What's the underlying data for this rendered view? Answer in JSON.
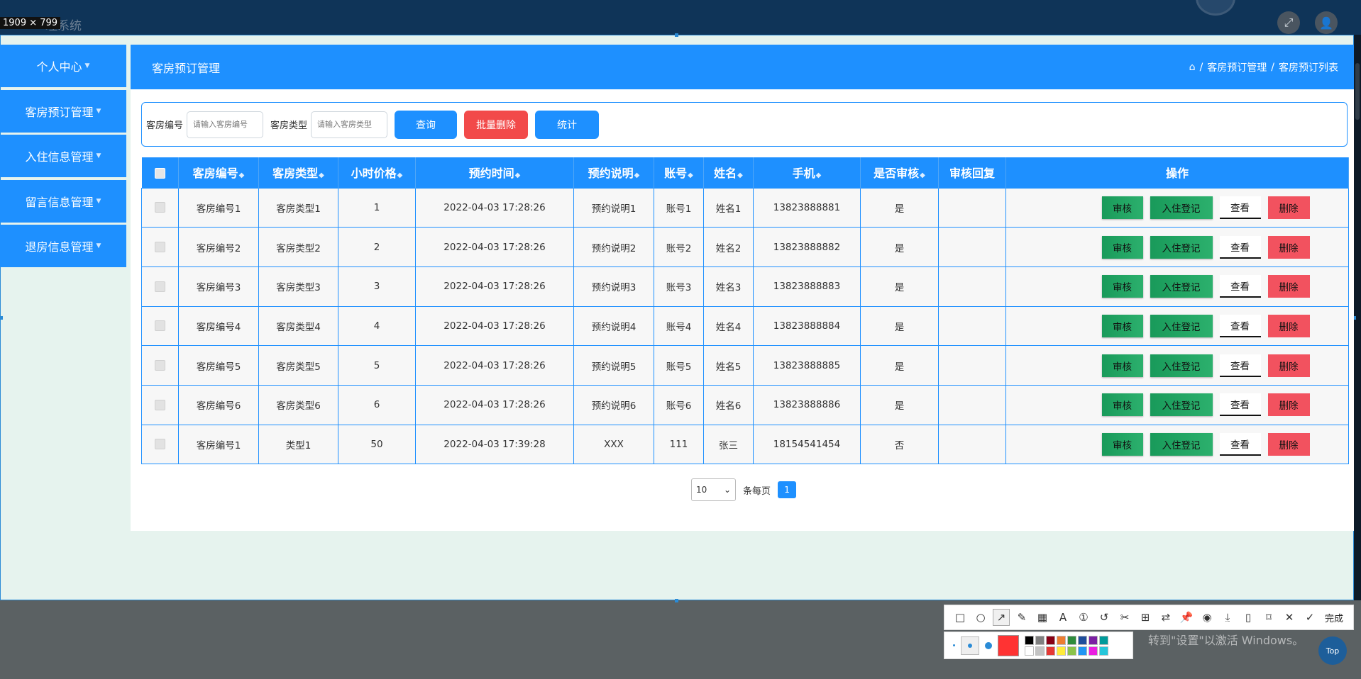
{
  "app": {
    "title_partial": "理系统",
    "screenshot_size": "1909 × 799"
  },
  "sidebar": {
    "items": [
      {
        "label": "个人中心"
      },
      {
        "label": "客房预订管理"
      },
      {
        "label": "入住信息管理"
      },
      {
        "label": "留言信息管理"
      },
      {
        "label": "退房信息管理"
      }
    ]
  },
  "page": {
    "title": "客房预订管理",
    "breadcrumb": [
      "客房预订管理",
      "客房预订列表"
    ]
  },
  "search": {
    "room_no_label": "客房编号",
    "room_no_placeholder": "请输入客房编号",
    "room_type_label": "客房类型",
    "room_type_placeholder": "请输入客房类型",
    "query_label": "查询",
    "batch_delete_label": "批量删除",
    "stats_label": "统计"
  },
  "table": {
    "headers": [
      "客房编号",
      "客房类型",
      "小时价格",
      "预约时间",
      "预约说明",
      "账号",
      "姓名",
      "手机",
      "是否审核",
      "审核回复",
      "操作"
    ],
    "actions": {
      "audit": "审核",
      "checkin": "入住登记",
      "view": "查看",
      "delete": "删除"
    },
    "rows": [
      {
        "room_no": "客房编号1",
        "room_type": "客房类型1",
        "price": "1",
        "time": "2022-04-03 17:28:26",
        "note": "预约说明1",
        "account": "账号1",
        "name": "姓名1",
        "phone": "13823888881",
        "audited": "是",
        "reply": ""
      },
      {
        "room_no": "客房编号2",
        "room_type": "客房类型2",
        "price": "2",
        "time": "2022-04-03 17:28:26",
        "note": "预约说明2",
        "account": "账号2",
        "name": "姓名2",
        "phone": "13823888882",
        "audited": "是",
        "reply": ""
      },
      {
        "room_no": "客房编号3",
        "room_type": "客房类型3",
        "price": "3",
        "time": "2022-04-03 17:28:26",
        "note": "预约说明3",
        "account": "账号3",
        "name": "姓名3",
        "phone": "13823888883",
        "audited": "是",
        "reply": ""
      },
      {
        "room_no": "客房编号4",
        "room_type": "客房类型4",
        "price": "4",
        "time": "2022-04-03 17:28:26",
        "note": "预约说明4",
        "account": "账号4",
        "name": "姓名4",
        "phone": "13823888884",
        "audited": "是",
        "reply": ""
      },
      {
        "room_no": "客房编号5",
        "room_type": "客房类型5",
        "price": "5",
        "time": "2022-04-03 17:28:26",
        "note": "预约说明5",
        "account": "账号5",
        "name": "姓名5",
        "phone": "13823888885",
        "audited": "是",
        "reply": ""
      },
      {
        "room_no": "客房编号6",
        "room_type": "客房类型6",
        "price": "6",
        "time": "2022-04-03 17:28:26",
        "note": "预约说明6",
        "account": "账号6",
        "name": "姓名6",
        "phone": "13823888886",
        "audited": "是",
        "reply": ""
      },
      {
        "room_no": "客房编号1",
        "room_type": "类型1",
        "price": "50",
        "time": "2022-04-03 17:39:28",
        "note": "XXX",
        "account": "111",
        "name": "张三",
        "phone": "18154541454",
        "audited": "否",
        "reply": ""
      }
    ]
  },
  "pagination": {
    "page_size": "10",
    "per_page_label": "条每页",
    "current_page": "1"
  },
  "snip_toolbar": {
    "finish_label": "完成",
    "palette": [
      "#000000",
      "#7f7f7f",
      "#880015",
      "#ed7d31",
      "#2e8b3c",
      "#1f4e9c",
      "#7b1fa2",
      "#009a9a",
      "#ffffff",
      "#c3c3c3",
      "#e53935",
      "#ffeb3b",
      "#8bc34a",
      "#2196f3",
      "#e91ee0",
      "#26c6da"
    ],
    "current_color": "#ff3333"
  },
  "watermark": {
    "line1": "激活 Windows",
    "line2": "转到\"设置\"以激活 Windows。"
  },
  "top_button": "Top"
}
